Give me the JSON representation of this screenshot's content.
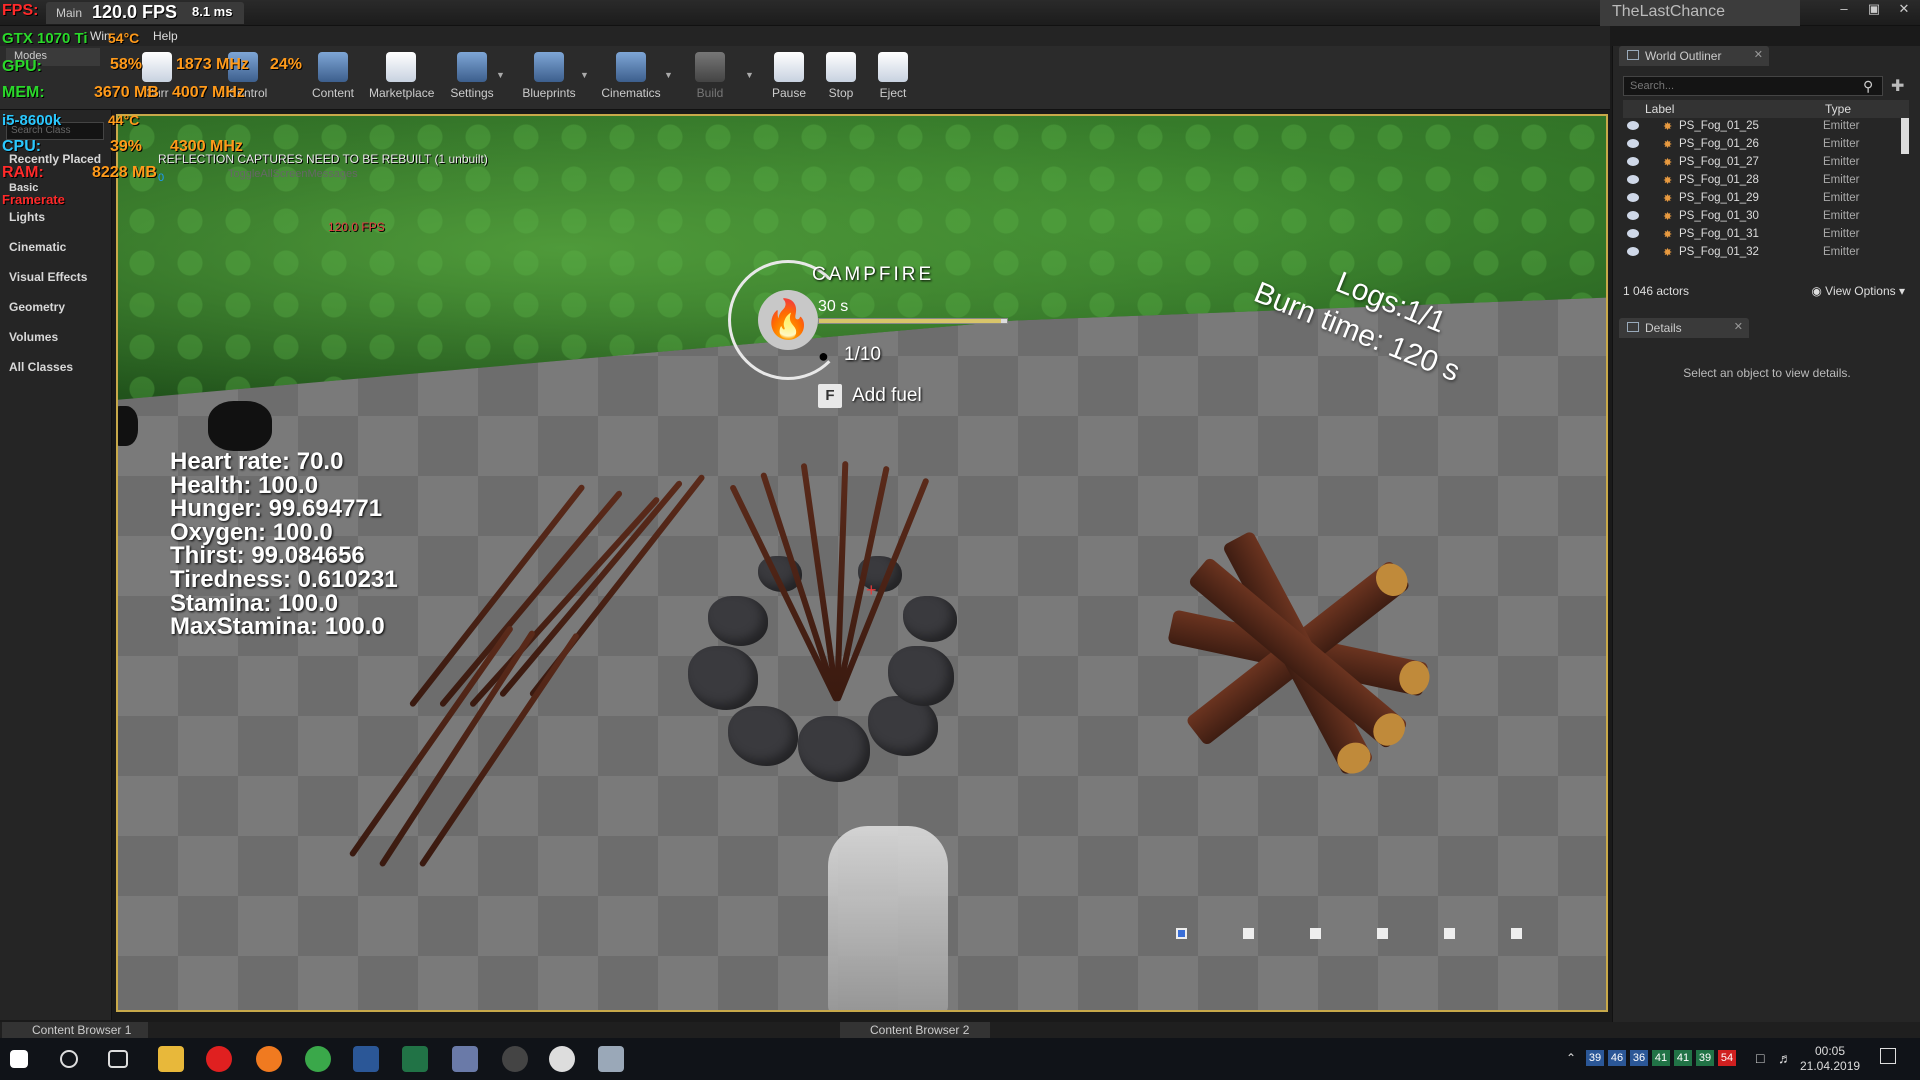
{
  "window": {
    "tab_label": "Main",
    "fps": "120.0 FPS",
    "frame_ms": "8.1 ms",
    "project_title": "TheLastChance"
  },
  "menu": {
    "items": [
      "Win",
      "Help"
    ]
  },
  "toolbar": {
    "buttons": [
      {
        "label": "Curr",
        "icon": "save-icon"
      },
      {
        "label": "e Control",
        "icon": "source-control-icon"
      },
      {
        "label": "Content",
        "icon": "content-icon"
      },
      {
        "label": "Marketplace",
        "icon": "marketplace-icon"
      },
      {
        "label": "Settings",
        "icon": "settings-icon"
      },
      {
        "label": "Blueprints",
        "icon": "blueprints-icon"
      },
      {
        "label": "Cinematics",
        "icon": "cinematics-icon"
      },
      {
        "label": "Build",
        "icon": "build-icon"
      },
      {
        "label": "Pause",
        "icon": "pause-icon"
      },
      {
        "label": "Stop",
        "icon": "stop-icon"
      },
      {
        "label": "Eject",
        "icon": "eject-icon"
      }
    ]
  },
  "hw_overlay": {
    "fps_label": "FPS:",
    "gpu_name": "GTX 1070 Ti",
    "gpu_temp": "54°C",
    "gpu_label": "GPU:",
    "gpu_load": "58%",
    "gpu_clock": "1873 MHz",
    "gpu_fan": "24%",
    "mem_label": "MEM:",
    "vram": "3670 MB",
    "mem_clock": "4007 MHz",
    "cpu_name": "i5-8600k",
    "cpu_temp": "44°C",
    "cpu_label": "CPU:",
    "cpu_load": "39%",
    "cpu_clock": "4300 MHz",
    "ram_label": "RAM:",
    "ram_used": "8228 MB",
    "framerate_label": "Framerate"
  },
  "modes_panel": {
    "tab": "Modes",
    "search_placeholder": "Search Class",
    "items": [
      "Recently Placed",
      "Basic",
      "Lights",
      "Cinematic",
      "Visual Effects",
      "Geometry",
      "Volumes",
      "All Classes"
    ]
  },
  "viewport": {
    "reflection_message": "REFLECTION CAPTURES NEED TO BE REBUILT (1 unbuilt)",
    "screen_msg": "ToggleAllScreenMessages",
    "cam_value": "0",
    "fps_small": "120.0 FPS",
    "stats": [
      "Heart rate: 70.0",
      "Health: 100.0",
      "Hunger: 99.694771",
      "Oxygen: 100.0",
      "Thirst: 99.084656",
      "Tiredness: 0.610231",
      "Stamina: 100.0",
      "MaxStamina: 100.0"
    ],
    "campfire": {
      "title": "CAMPFIRE",
      "timer": "30 s",
      "timer_fill_fraction": 0.97,
      "fuel": "1/10",
      "key": "F",
      "action": "Add fuel"
    },
    "burn": {
      "logs": "Logs:1/1",
      "burn_time": "Burn time: 120 s"
    },
    "slots": {
      "count": 6,
      "active_index": 0
    },
    "crosshair": "+"
  },
  "world_outliner": {
    "tab": "World Outliner",
    "search_placeholder": "Search...",
    "col_label": "Label",
    "col_type": "Type",
    "rows": [
      {
        "label": "PS_Fog_01_25",
        "type": "Emitter"
      },
      {
        "label": "PS_Fog_01_26",
        "type": "Emitter"
      },
      {
        "label": "PS_Fog_01_27",
        "type": "Emitter"
      },
      {
        "label": "PS_Fog_01_28",
        "type": "Emitter"
      },
      {
        "label": "PS_Fog_01_29",
        "type": "Emitter"
      },
      {
        "label": "PS_Fog_01_30",
        "type": "Emitter"
      },
      {
        "label": "PS_Fog_01_31",
        "type": "Emitter"
      },
      {
        "label": "PS_Fog_01_32",
        "type": "Emitter"
      }
    ],
    "actor_count": "1 046 actors",
    "view_options": "View Options"
  },
  "details": {
    "tab": "Details",
    "message": "Select an object to view details."
  },
  "content_browsers": [
    "Content Browser 1",
    "Content Browser 2"
  ],
  "taskbar": {
    "tray_badges": [
      "39",
      "46",
      "36",
      "41",
      "41",
      "39",
      "54"
    ],
    "time": "00:05",
    "date": "21.04.2019"
  },
  "colors": {
    "viewport_border": "#c8a94a",
    "hw_red": "#ff2a2a",
    "hw_orange": "#ff9a1a",
    "hw_green": "#2ad82a",
    "hw_cyan": "#2ac8ff"
  }
}
